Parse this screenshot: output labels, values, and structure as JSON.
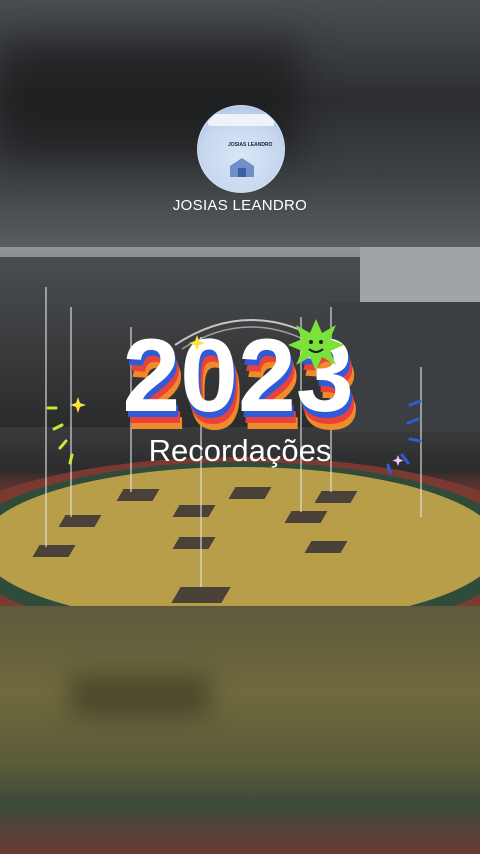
{
  "profile": {
    "name": "JOSIAS LEANDRO",
    "avatar_title": "JOSIAS LEANDRO"
  },
  "post": {
    "year": "2023",
    "subtitle": "Recordações"
  },
  "colors": {
    "stripe_red": "#e8423a",
    "stripe_blue": "#2f5bd8",
    "stripe_orange": "#f08a2a",
    "sun_green": "#7be23a",
    "sparkle_yellow": "#ffe23a"
  }
}
